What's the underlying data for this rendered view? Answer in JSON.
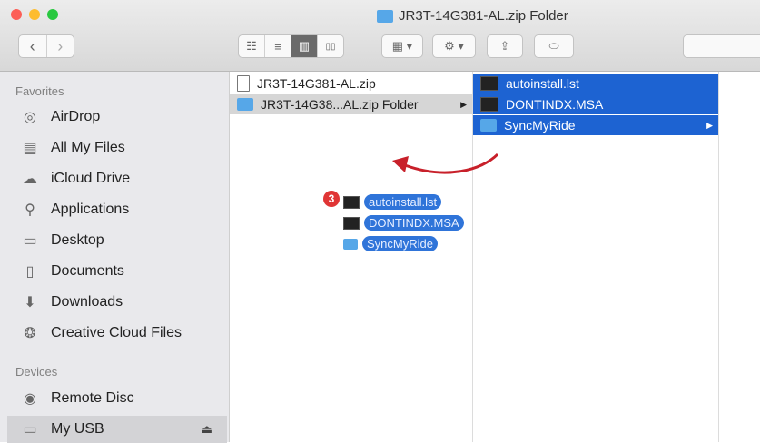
{
  "window": {
    "title": "JR3T-14G381-AL.zip Folder",
    "traffic_lights": {
      "close": "#fc5f57",
      "minimize": "#fdbc2e",
      "zoom": "#29c840"
    }
  },
  "toolbar": {
    "back": "‹",
    "forward": "›",
    "view_icons": "☷",
    "view_list": "≡",
    "view_columns": "▥",
    "view_cover": "▯▯",
    "arrange": "▦ ▾",
    "action": "⚙ ▾",
    "share": "⇪",
    "tag": "⬭"
  },
  "sidebar": {
    "favorites_label": "Favorites",
    "devices_label": "Devices",
    "favorites": [
      {
        "label": "AirDrop",
        "icon": "airdrop-icon"
      },
      {
        "label": "All My Files",
        "icon": "all-files-icon"
      },
      {
        "label": "iCloud Drive",
        "icon": "cloud-icon"
      },
      {
        "label": "Applications",
        "icon": "applications-icon"
      },
      {
        "label": "Desktop",
        "icon": "desktop-icon"
      },
      {
        "label": "Documents",
        "icon": "documents-icon"
      },
      {
        "label": "Downloads",
        "icon": "downloads-icon"
      },
      {
        "label": "Creative Cloud Files",
        "icon": "creative-cloud-icon"
      }
    ],
    "devices": [
      {
        "label": "Remote Disc",
        "icon": "disc-icon"
      },
      {
        "label": "My USB",
        "icon": "usb-drive-icon",
        "eject": "⏏"
      }
    ]
  },
  "column1": [
    {
      "label": "JR3T-14G381-AL.zip",
      "icon": "zip-file-icon"
    },
    {
      "label": "JR3T-14G38...AL.zip Folder",
      "icon": "folder-icon"
    }
  ],
  "column2": [
    {
      "label": "autoinstall.lst",
      "icon": "file-icon"
    },
    {
      "label": "DONTINDX.MSA",
      "icon": "file-icon"
    },
    {
      "label": "SyncMyRide",
      "icon": "folder-icon"
    }
  ],
  "drag_preview": {
    "count": "3",
    "items": [
      "autoinstall.lst",
      "DONTINDX.MSA",
      "SyncMyRide"
    ]
  },
  "colors": {
    "selection": "#1d63d2",
    "arrow": "#c8202a",
    "folder": "#56a7e8"
  }
}
